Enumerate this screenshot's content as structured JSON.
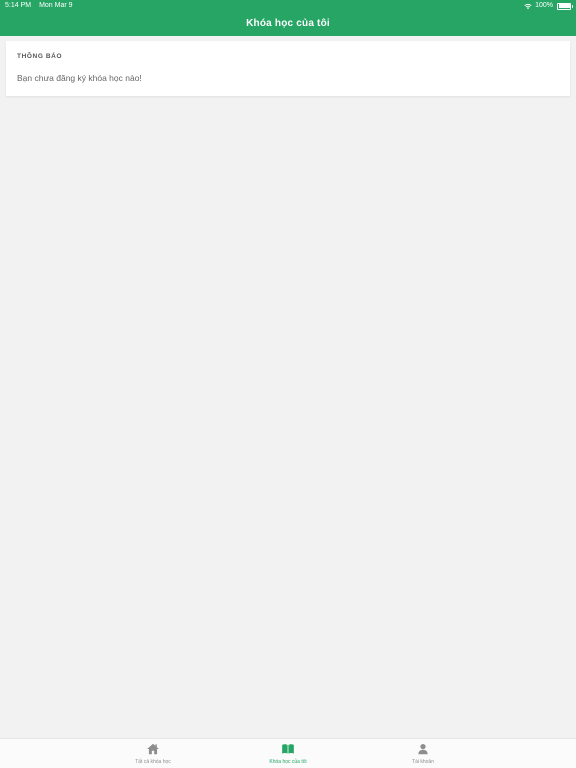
{
  "status_bar": {
    "time": "5:14 PM",
    "date": "Mon Mar 9",
    "battery": "100%",
    "wifi_icon": "wifi-icon",
    "battery_icon": "battery-icon"
  },
  "header": {
    "title": "Khóa học của tôi",
    "background_color": "#26a565"
  },
  "notice_card": {
    "title": "THÔNG BÁO",
    "message": "Bạn chưa đăng ký khóa học nào!"
  },
  "tabbar": {
    "active_color": "#26a565",
    "inactive_color": "#8e8e8e",
    "tabs": [
      {
        "label": "Tất cả khóa học",
        "icon": "home-icon",
        "active": false
      },
      {
        "label": "Khóa học của tôi",
        "icon": "book-icon",
        "active": true
      },
      {
        "label": "Tài khoản",
        "icon": "person-icon",
        "active": false
      }
    ]
  }
}
